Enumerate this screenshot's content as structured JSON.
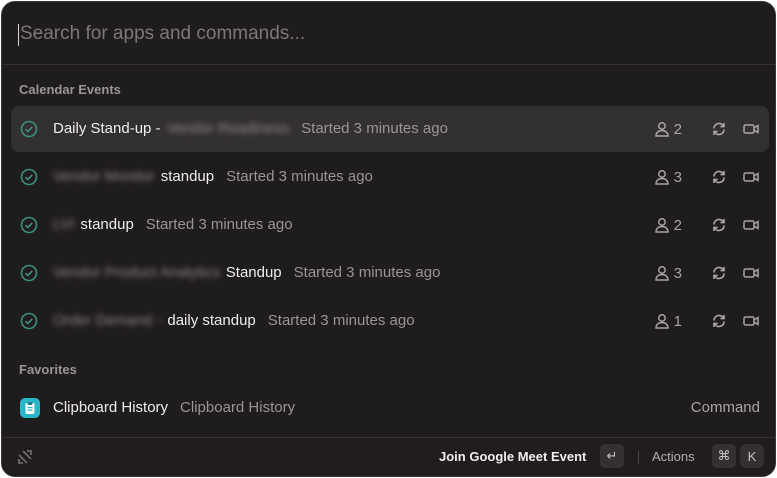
{
  "search": {
    "placeholder": "Search for apps and commands..."
  },
  "sections": {
    "calendar": "Calendar Events",
    "favorites": "Favorites"
  },
  "events": [
    {
      "blurred": "Vendor Readiness",
      "prefix": "Daily Stand-up -",
      "suffix": "",
      "subtitle": "Started 3 minutes ago",
      "attendees": "2",
      "selected": true
    },
    {
      "blurred": "Vendor Monitor",
      "prefix": "",
      "suffix": "standup",
      "subtitle": "Started 3 minutes ago",
      "attendees": "3",
      "selected": false
    },
    {
      "blurred": "LVI",
      "prefix": "",
      "suffix": "standup",
      "subtitle": "Started 3 minutes ago",
      "attendees": "2",
      "selected": false
    },
    {
      "blurred": "Vendor Product Analytics",
      "prefix": "",
      "suffix": "Standup",
      "subtitle": "Started 3 minutes ago",
      "attendees": "3",
      "selected": false
    },
    {
      "blurred": "Order Demand -",
      "prefix": "",
      "suffix": "daily standup",
      "subtitle": "Started 3 minutes ago",
      "attendees": "1",
      "selected": false
    }
  ],
  "favorites": [
    {
      "title": "Clipboard History",
      "subtitle": "Clipboard History",
      "type": "Command",
      "icon": "clipboard-icon"
    }
  ],
  "footer": {
    "primary_action": "Join Google Meet Event",
    "enter_key": "↵",
    "actions_label": "Actions",
    "cmd_key": "⌘",
    "k_key": "K"
  },
  "colors": {
    "background": "#1f1c1d",
    "selected": "#333031",
    "accent": "#27b7c7"
  }
}
